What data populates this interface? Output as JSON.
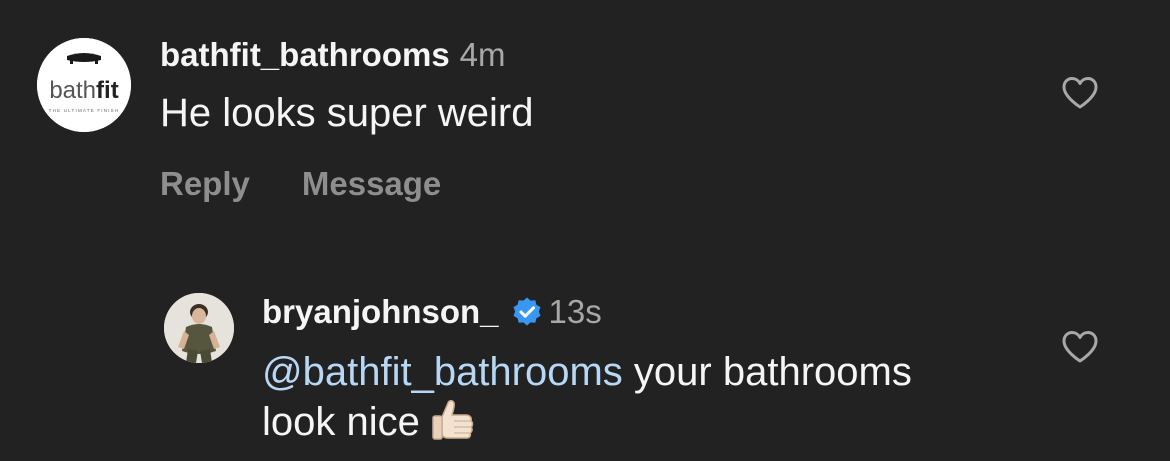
{
  "comments": [
    {
      "avatar_logo_text": "bathfit",
      "avatar_tagline": "THE ULTIMATE FINISH",
      "username": "bathfit_bathrooms",
      "time": "4m",
      "text": "He looks super weird",
      "like_icon": "heart-outline-icon"
    },
    {
      "username": "bryanjohnson_",
      "verified_icon": "verified-badge-icon",
      "time": "13s",
      "mention": "@bathfit_bathrooms",
      "text_line1_rest": " your bathrooms",
      "text_line2": "look nice",
      "emoji": "thumbs-up-icon",
      "like_icon": "heart-outline-icon"
    }
  ],
  "actions": {
    "reply": "Reply",
    "message": "Message"
  },
  "colors": {
    "background": "#222222",
    "text_primary": "#f5f5f5",
    "text_secondary": "#a8a8a8",
    "action_text": "#8e8e8e",
    "verified_blue": "#3897f0",
    "mention": "#b7d7f4"
  }
}
